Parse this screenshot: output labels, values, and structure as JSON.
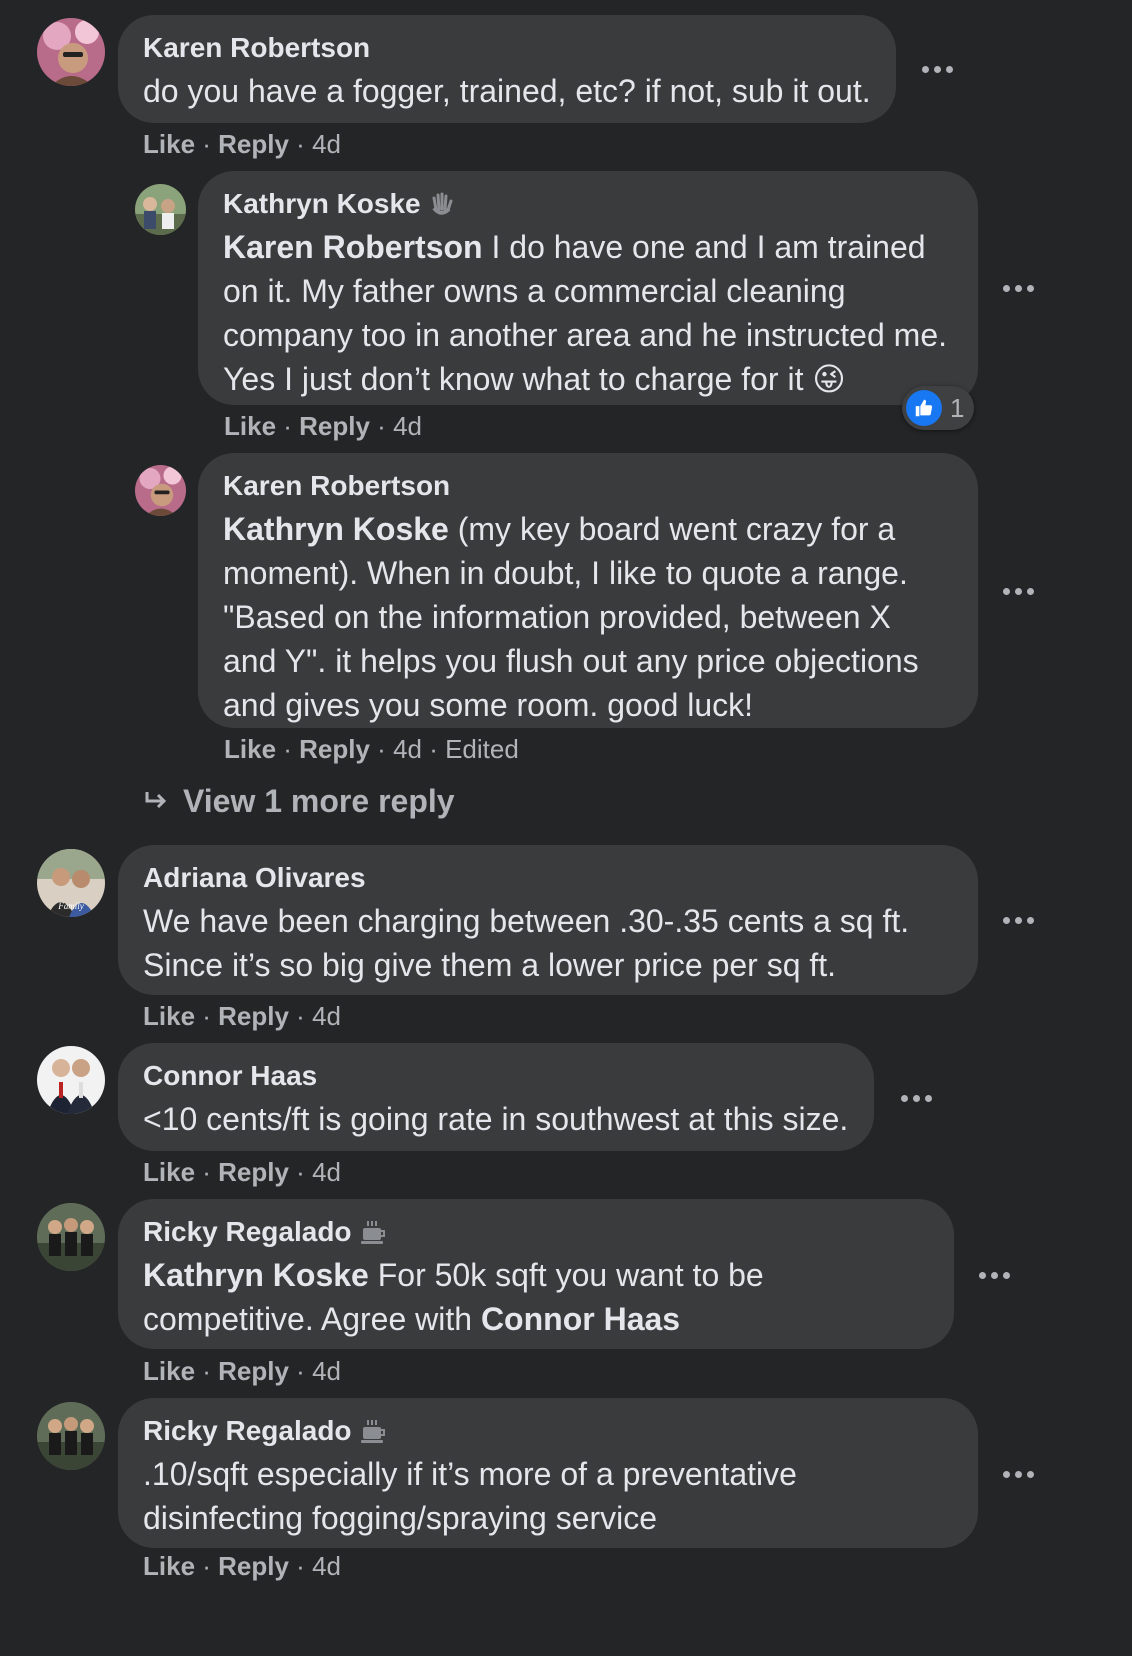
{
  "comments": [
    {
      "author": "Karen Robertson",
      "text": "do you have a fogger, trained, etc? if not, sub it out.",
      "like": "Like",
      "reply": "Reply",
      "time": "4d"
    },
    {
      "author": "Kathryn Koske",
      "author_badge_icon": "wave-icon",
      "mention": "Karen Robertson",
      "text": " I do have one and I am trained on it. My father owns a commercial cleaning company too in another area and he instructed me. Yes I just don’t know what to charge for it 😜",
      "like": "Like",
      "reply": "Reply",
      "time": "4d",
      "reaction_count": "1"
    },
    {
      "author": "Karen Robertson",
      "mention": "Kathryn Koske",
      "text": " (my key board went crazy for a moment). When in doubt, I like to quote a range. \"Based on the information provided, between X and Y\". it helps you flush out any price objections and gives you some room. good luck!",
      "like": "Like",
      "reply": "Reply",
      "time": "4d",
      "edited": "Edited"
    },
    {
      "author": "Adriana Olivares",
      "text": "We have been charging between .30-.35 cents a sq ft. Since it’s so big give them a lower price per sq ft.",
      "like": "Like",
      "reply": "Reply",
      "time": "4d"
    },
    {
      "author": "Connor Haas",
      "text": "<10 cents/ft is going rate in southwest at this size.",
      "like": "Like",
      "reply": "Reply",
      "time": "4d"
    },
    {
      "author": "Ricky Regalado",
      "author_badge_icon": "coffee-cup-icon",
      "mention": "Kathryn Koske",
      "text": " For 50k sqft you want to be competitive. Agree with ",
      "mention2": "Connor Haas",
      "like": "Like",
      "reply": "Reply",
      "time": "4d"
    },
    {
      "author": "Ricky Regalado",
      "author_badge_icon": "coffee-cup-icon",
      "text": ".10/sqft especially if it’s more of a preventative disinfecting fogging/spraying service",
      "like": "Like",
      "reply": "Reply",
      "time": "4d"
    }
  ],
  "view_more_replies": "View 1 more reply",
  "colors": {
    "background": "#242526",
    "bubble": "#3a3b3c",
    "primary_text": "#e4e6eb",
    "secondary_text": "#b0b3b8",
    "like_blue": "#1877f2"
  }
}
